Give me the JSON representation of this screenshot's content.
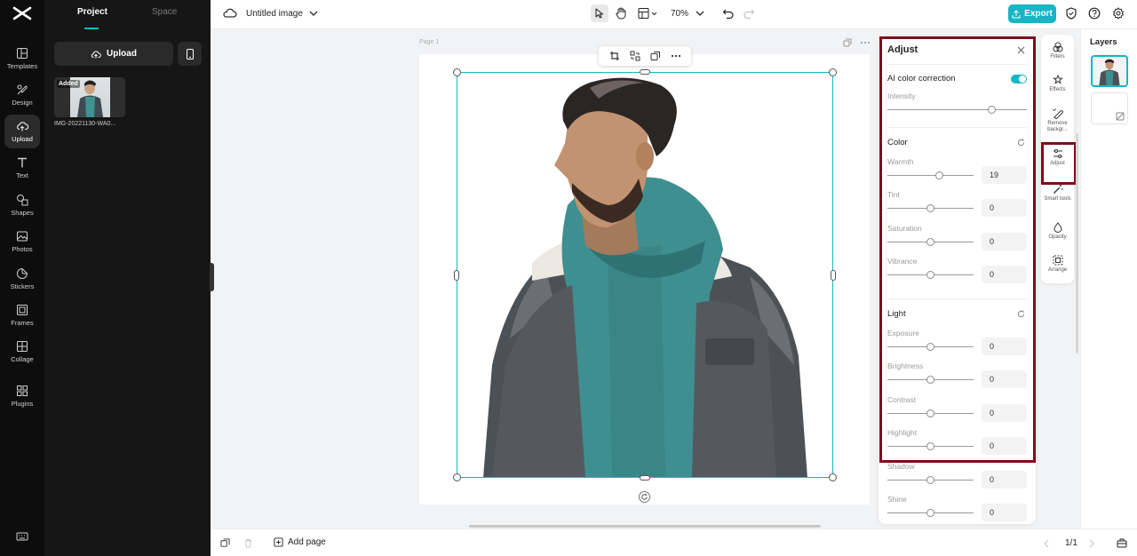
{
  "rail": {
    "items": [
      {
        "label": "Templates",
        "icon": "templates-icon"
      },
      {
        "label": "Design",
        "icon": "design-icon"
      },
      {
        "label": "Upload",
        "icon": "upload-cloud-icon",
        "active": true
      },
      {
        "label": "Text",
        "icon": "text-icon"
      },
      {
        "label": "Shapes",
        "icon": "shapes-icon"
      },
      {
        "label": "Photos",
        "icon": "photos-icon"
      },
      {
        "label": "Stickers",
        "icon": "stickers-icon"
      },
      {
        "label": "Frames",
        "icon": "frames-icon"
      },
      {
        "label": "Collage",
        "icon": "collage-icon"
      },
      {
        "label": "Plugins",
        "icon": "plugins-icon"
      }
    ]
  },
  "panel": {
    "tabs": [
      "Project",
      "Space"
    ],
    "upload_label": "Upload",
    "asset": {
      "badge": "Added",
      "name": "IMG-20221130-WA0..."
    }
  },
  "topbar": {
    "title": "Untitled image",
    "zoom": "70%",
    "export_label": "Export"
  },
  "canvas": {
    "page_label": "Page 1"
  },
  "bottombar": {
    "add_page_label": "Add page",
    "page_count": "1/1"
  },
  "adjust": {
    "title": "Adjust",
    "ai_label": "AI color correction",
    "ai_enabled": true,
    "intensity_label": "Intensity",
    "intensity_value": 0.75,
    "sections": [
      {
        "title": "Color",
        "sliders": [
          {
            "label": "Warmth",
            "value": "19",
            "pos": 0.6
          },
          {
            "label": "Tint",
            "value": "0",
            "pos": 0.5
          },
          {
            "label": "Saturation",
            "value": "0",
            "pos": 0.5
          },
          {
            "label": "Vibrance",
            "value": "0",
            "pos": 0.5
          }
        ]
      },
      {
        "title": "Light",
        "sliders": [
          {
            "label": "Exposure",
            "value": "0",
            "pos": 0.5
          },
          {
            "label": "Brightness",
            "value": "0",
            "pos": 0.5
          },
          {
            "label": "Contrast",
            "value": "0",
            "pos": 0.5
          },
          {
            "label": "Highlight",
            "value": "0",
            "pos": 0.5
          },
          {
            "label": "Shadow",
            "value": "0",
            "pos": 0.5
          },
          {
            "label": "Shine",
            "value": "0",
            "pos": 0.5
          }
        ]
      }
    ]
  },
  "tools": [
    {
      "label": "Filters",
      "icon": "filters-icon"
    },
    {
      "label": "Effects",
      "icon": "effects-icon"
    },
    {
      "label": "Remove backgr...",
      "icon": "remove-background-icon"
    },
    {
      "label": "Adjust",
      "icon": "adjust-icon"
    },
    {
      "label": "Smart tools",
      "icon": "smart-tools-icon"
    },
    {
      "label": "Opacity",
      "icon": "opacity-icon"
    },
    {
      "label": "Arrange",
      "icon": "arrange-icon"
    }
  ],
  "layers": {
    "title": "Layers"
  },
  "colors": {
    "accent": "#18b5c4",
    "highlight": "#7f0c1c",
    "rail_bg": "#0d0d0d",
    "panel_bg": "#161616"
  }
}
